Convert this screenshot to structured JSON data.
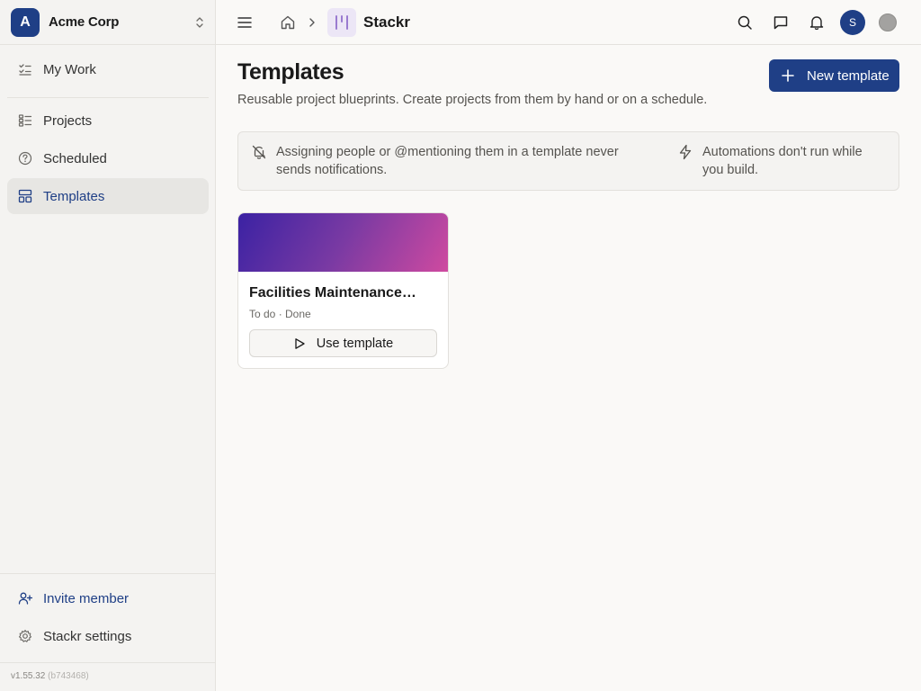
{
  "org": {
    "initial": "A",
    "name": "Acme Corp"
  },
  "sidebar": {
    "my_work": "My Work",
    "items": [
      {
        "label": "Projects",
        "icon": "projects-list-icon"
      },
      {
        "label": "Scheduled",
        "icon": "question-circle-icon"
      },
      {
        "label": "Templates",
        "icon": "templates-icon",
        "active": true
      }
    ],
    "invite": "Invite member",
    "settings": "Stackr settings",
    "version": "v1.55.32",
    "build": "(b743468)"
  },
  "topbar": {
    "app_name": "Stackr",
    "user_initial": "S"
  },
  "page": {
    "title": "Templates",
    "subtitle": "Reusable project blueprints. Create projects from them by hand or on a schedule.",
    "new_button": "New template"
  },
  "notice": {
    "notifications": "Assigning people or @mentioning them in a template never sends notifications.",
    "automations": "Automations don't run while you build."
  },
  "templates": [
    {
      "title": "Facilities Maintenance…",
      "statuses": "To do · Done",
      "use_label": "Use template"
    }
  ],
  "colors": {
    "accent": "#1f3f86",
    "cover_start": "#3b22a3",
    "cover_end": "#cf4aa0"
  }
}
